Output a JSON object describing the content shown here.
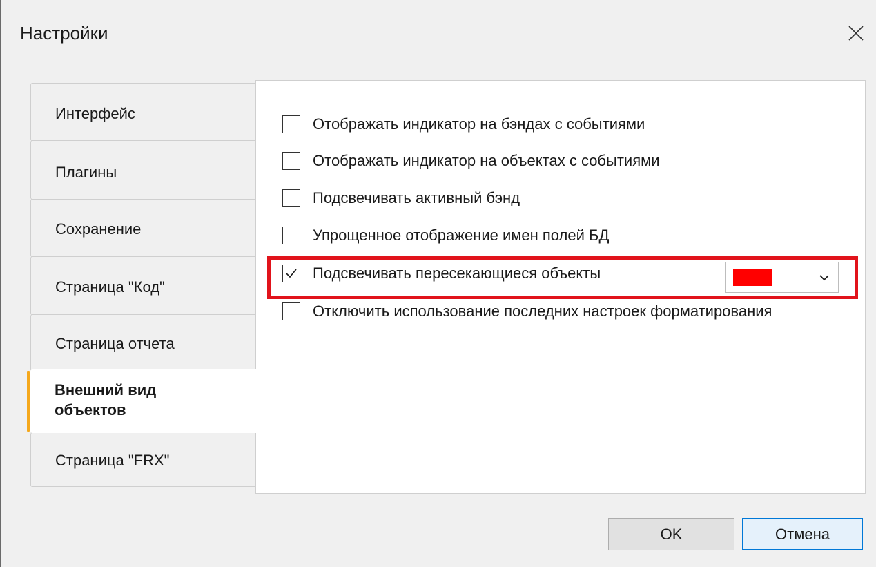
{
  "window": {
    "title": "Настройки"
  },
  "tabs": [
    {
      "label": "Интерфейс",
      "active": false
    },
    {
      "label": "Плагины",
      "active": false
    },
    {
      "label": "Сохранение",
      "active": false
    },
    {
      "label": "Страница \"Код\"",
      "active": false
    },
    {
      "label": "Страница отчета",
      "active": false
    },
    {
      "label": "Внешний вид объектов",
      "active": true
    },
    {
      "label": "Страница \"FRX\"",
      "active": false
    }
  ],
  "options": [
    {
      "label": "Отображать индикатор на бэндах с событиями",
      "checked": false
    },
    {
      "label": "Отображать индикатор на объектах с событиями",
      "checked": false
    },
    {
      "label": "Подсвечивать активный бэнд",
      "checked": false
    },
    {
      "label": "Упрощенное отображение имен полей БД",
      "checked": false
    },
    {
      "label": "Подсвечивать пересекающиеся объекты",
      "checked": true
    },
    {
      "label": "Отключить использование последних настроек форматирования",
      "checked": false
    }
  ],
  "color_picker": {
    "selected_color": "#ff0000"
  },
  "annotation": {
    "highlight_color": "#e1131b"
  },
  "accent_color": "#f5a81c",
  "buttons": {
    "ok": "OK",
    "cancel": "Отмена"
  },
  "icons": {
    "close": "close-icon",
    "check": "checkmark-icon",
    "dropdown": "chevron-down-icon"
  }
}
